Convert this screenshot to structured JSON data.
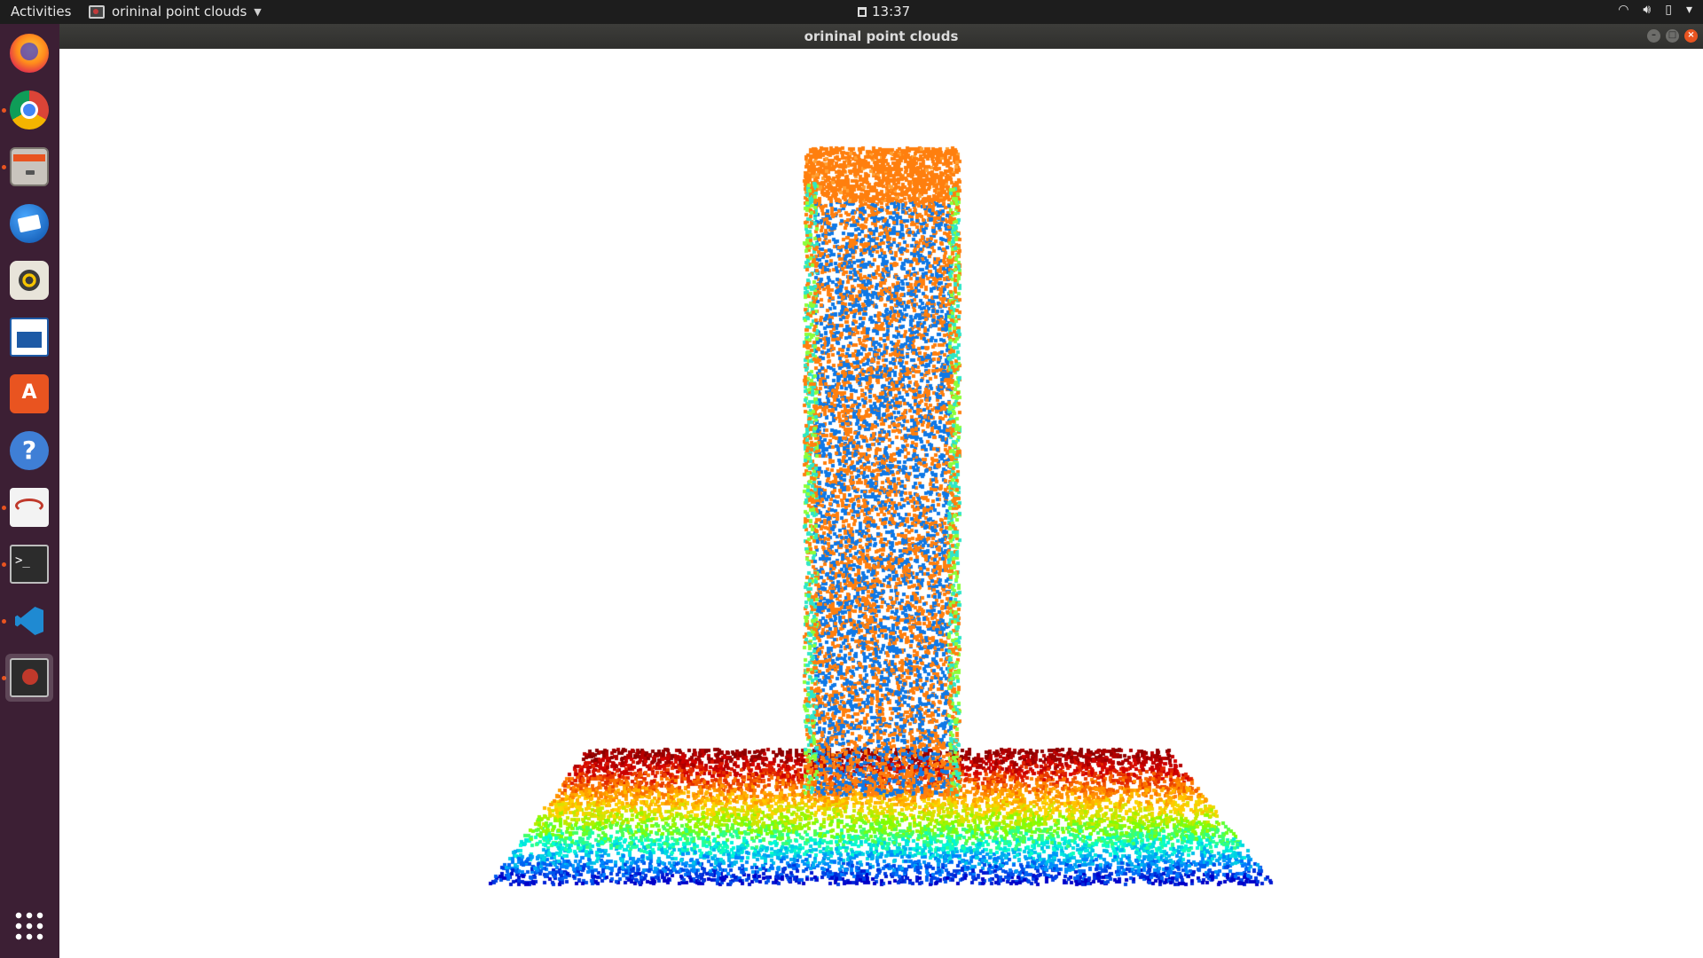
{
  "topbar": {
    "activities": "Activities",
    "app_menu": "orininal point clouds",
    "clock": "13:37",
    "tray_icons": [
      "wifi-icon",
      "volume-icon",
      "battery-icon",
      "system-menu-icon"
    ]
  },
  "window": {
    "title": "orininal point clouds"
  },
  "dock": {
    "items": [
      {
        "name": "firefox",
        "running": false
      },
      {
        "name": "chrome",
        "running": true
      },
      {
        "name": "files",
        "running": true
      },
      {
        "name": "thunderbird",
        "running": false
      },
      {
        "name": "rhythmbox",
        "running": false
      },
      {
        "name": "libreoffice-writer",
        "running": false
      },
      {
        "name": "ubuntu-software",
        "running": false
      },
      {
        "name": "help",
        "running": false
      },
      {
        "name": "document-viewer",
        "running": true
      },
      {
        "name": "terminal",
        "running": true
      },
      {
        "name": "vscode",
        "running": true
      },
      {
        "name": "point-cloud-viewer",
        "running": true,
        "active": true
      }
    ],
    "show_apps": "show-applications"
  },
  "viewer": {
    "background": "#ffffff",
    "colormap": [
      "#8b0000",
      "#d60000",
      "#ff7f00",
      "#ffd500",
      "#7fff00",
      "#00ffd5",
      "#0080ff",
      "#0000c8"
    ]
  }
}
